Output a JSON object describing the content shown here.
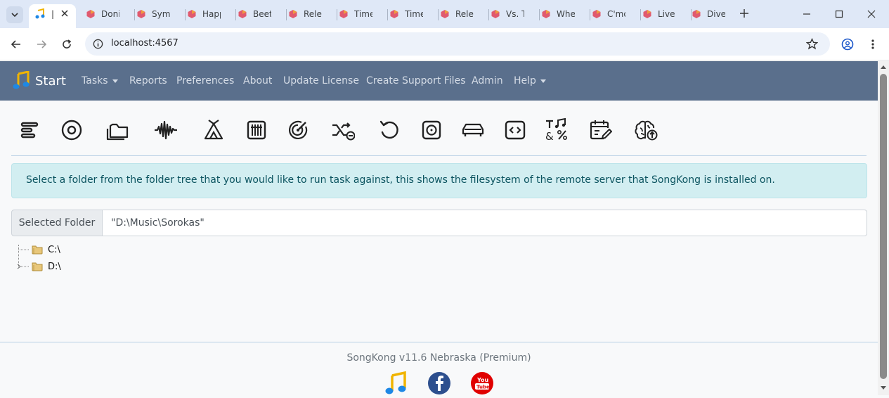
{
  "browser": {
    "tabs": [
      {
        "title": "Doni"
      },
      {
        "title": "Symp"
      },
      {
        "title": "Happ"
      },
      {
        "title": "Beet"
      },
      {
        "title": "Relea"
      },
      {
        "title": "Time"
      },
      {
        "title": "Time"
      },
      {
        "title": "Relea"
      },
      {
        "title": "Vs. T"
      },
      {
        "title": "Whe"
      },
      {
        "title": "C'mo"
      },
      {
        "title": "Live"
      },
      {
        "title": "Dive"
      }
    ],
    "url": "localhost:4567"
  },
  "navbar": {
    "brand": "Start",
    "items": {
      "tasks": "Tasks",
      "reports": "Reports",
      "preferences": "Preferences",
      "about": "About",
      "update_license": "Update License",
      "create_support_files": "Create Support Files",
      "admin": "Admin",
      "help": "Help"
    }
  },
  "toolbar_icons": [
    "list-icon",
    "disc-icon",
    "folders-icon",
    "waveform-icon",
    "tent-icon",
    "grid-icon",
    "radar-icon",
    "shuffle-icon",
    "undo-icon",
    "vinyl-icon",
    "car-icon",
    "code-icon",
    "music-text-icon",
    "calendar-edit-icon",
    "brain-upload-icon"
  ],
  "alert": {
    "text": "Select a folder from the folder tree that you would like to run task against, this shows the filesystem of the remote server that SongKong is installed on."
  },
  "selected_folder": {
    "label": "Selected Folder",
    "value": "\"D:\\Music\\Sorokas\""
  },
  "tree": {
    "nodes": [
      {
        "label": "C:\\"
      },
      {
        "label": "D:\\"
      }
    ]
  },
  "footer": {
    "version": "SongKong v11.6 Nebraska (Premium)"
  },
  "colors": {
    "navbar": "#5a6f8c",
    "alert_bg": "#d2eef1",
    "alert_text": "#0c5460",
    "facebook": "#2d4f8e",
    "youtube": "#e00000"
  }
}
